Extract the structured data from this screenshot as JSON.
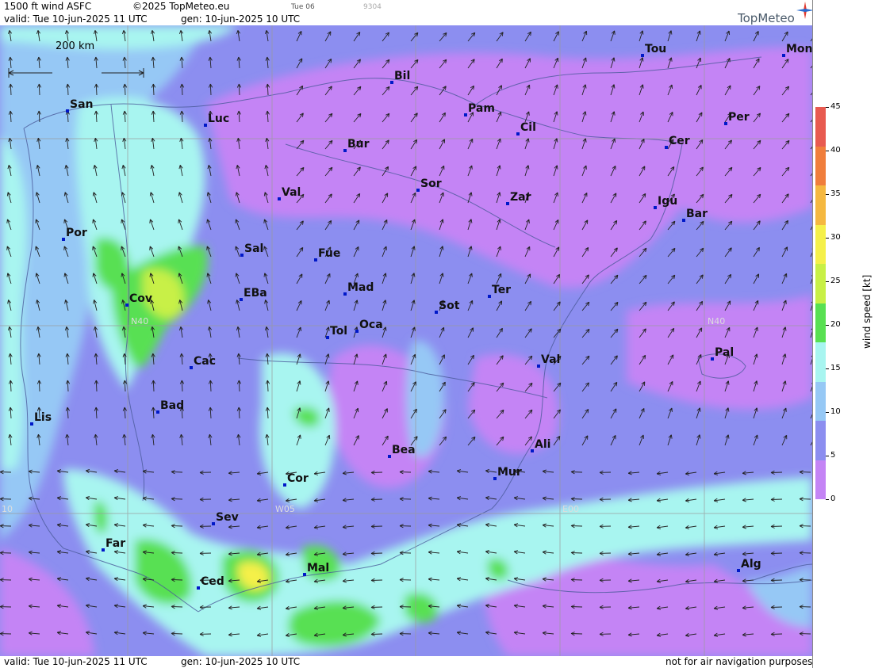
{
  "header": {
    "product": "1500 ft wind ASFC",
    "copyright": "©2025 TopMeteo.eu",
    "small_code1": "Tue 06",
    "small_code2": "9304",
    "valid": "valid:  Tue  10-jun-2025  11 UTC",
    "gen": "gen: 10-jun-2025 10 UTC",
    "brand": "TopMeteo"
  },
  "footer": {
    "valid": "valid:  Tue  10-jun-2025  11 UTC",
    "gen": "gen: 10-jun-2025 10 UTC",
    "note": "not for air navigation purposes"
  },
  "scale_label": "200 km",
  "grid_labels": [
    "N40",
    "N40",
    "W05",
    "E00",
    "10"
  ],
  "legend": {
    "title": "wind speed [kt]",
    "ticks": [
      "45",
      "40",
      "35",
      "30",
      "25",
      "20",
      "15",
      "10",
      "5",
      "0"
    ],
    "colors": [
      "#e85a50",
      "#f07e3c",
      "#f5b840",
      "#f5f04a",
      "#c8f046",
      "#58e052",
      "#a8f5f0",
      "#96c8f5",
      "#8c8ef0",
      "#c484f5"
    ]
  },
  "cities": [
    {
      "name": "Tou"
    },
    {
      "name": "Mon"
    },
    {
      "name": "Bil"
    },
    {
      "name": "San"
    },
    {
      "name": "Luc"
    },
    {
      "name": "Pam"
    },
    {
      "name": "Per"
    },
    {
      "name": "Cil"
    },
    {
      "name": "Bur"
    },
    {
      "name": "Cer"
    },
    {
      "name": "Sor"
    },
    {
      "name": "Val"
    },
    {
      "name": "Zar"
    },
    {
      "name": "Igu"
    },
    {
      "name": "Bar"
    },
    {
      "name": "Por"
    },
    {
      "name": "Sal"
    },
    {
      "name": "Fue"
    },
    {
      "name": "Mad"
    },
    {
      "name": "Ter"
    },
    {
      "name": "Cov"
    },
    {
      "name": "EBa"
    },
    {
      "name": "Sot"
    },
    {
      "name": "Tol"
    },
    {
      "name": "Oca"
    },
    {
      "name": "Pal"
    },
    {
      "name": "Cac"
    },
    {
      "name": "Val"
    },
    {
      "name": "Bad"
    },
    {
      "name": "Lis"
    },
    {
      "name": "Bea"
    },
    {
      "name": "Ali"
    },
    {
      "name": "Mur"
    },
    {
      "name": "Cor"
    },
    {
      "name": "Sev"
    },
    {
      "name": "Far"
    },
    {
      "name": "Mal"
    },
    {
      "name": "Ced"
    },
    {
      "name": "Alg"
    }
  ]
}
